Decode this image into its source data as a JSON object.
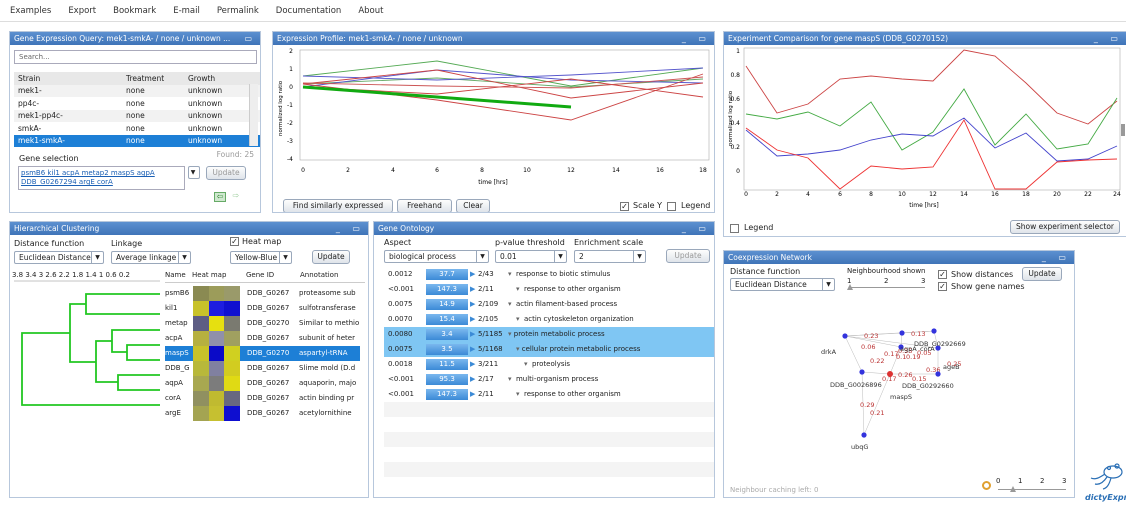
{
  "menu": [
    "Examples",
    "Export",
    "Bookmark",
    "E-mail",
    "Permalink",
    "Documentation",
    "About"
  ],
  "query": {
    "title": "Gene Expression Query: mek1-smkA- / none / unknown ...",
    "search_placeholder": "Search...",
    "columns": [
      "Strain",
      "Treatment",
      "Growth"
    ],
    "rows": [
      {
        "strain": "mek1-",
        "treatment": "none",
        "growth": "unknown"
      },
      {
        "strain": "pp4c-",
        "treatment": "none",
        "growth": "unknown"
      },
      {
        "strain": "mek1-pp4c-",
        "treatment": "none",
        "growth": "unknown"
      },
      {
        "strain": "smkA-",
        "treatment": "none",
        "growth": "unknown"
      },
      {
        "strain": "mek1-smkA-",
        "treatment": "none",
        "growth": "unknown"
      }
    ],
    "found": "Found: 25",
    "gene_selection_label": "Gene selection",
    "genes_line1": "psmB6 kil1 acpA metap2 maspS agpA",
    "genes_line2": "DDB_G0267294 argE corA",
    "update_label": "Update"
  },
  "profile": {
    "title": "Expression Profile: mek1-smkA- / none / unknown",
    "find_label": "Find similarly expressed",
    "freehand_label": "Freehand",
    "clear_label": "Clear",
    "scale_y_label": "Scale Y",
    "legend_label": "Legend",
    "chart": {
      "xlabel": "time [hrs]",
      "ylabel": "normalized log ratio",
      "xticks": [
        "0",
        "2",
        "4",
        "6",
        "8",
        "10",
        "12",
        "14",
        "16",
        "18"
      ],
      "yticks": [
        "2",
        "1",
        "0",
        "-1",
        "-2",
        "-3",
        "-4"
      ]
    }
  },
  "comparison": {
    "title": "Experiment Comparison for gene maspS (DDB_G0270152)",
    "legend_label": "Legend",
    "show_selector_label": "Show experiment selector",
    "chart": {
      "xlabel": "time [hrs]",
      "ylabel": "normalized log ratio",
      "xticks": [
        "0",
        "2",
        "4",
        "6",
        "8",
        "10",
        "12",
        "14",
        "16",
        "18",
        "20",
        "22",
        "24"
      ],
      "yticks": [
        "1",
        "0.8",
        "0.6",
        "0.4",
        "0.2",
        "0"
      ]
    }
  },
  "hc": {
    "title": "Hierarchical Clustering",
    "distance_label": "Distance function",
    "distance_value": "Euclidean Distance",
    "linkage_label": "Linkage",
    "linkage_value": "Average linkage",
    "heatmap_label": "Heat map",
    "color_value": "Yellow-Blue",
    "update_label": "Update",
    "scale": "3.8 3.4  3  2.6 2.2 1.8 1.4  1  0.6 0.2",
    "columns": [
      "Name",
      "Heat map",
      "Gene ID",
      "Annotation"
    ],
    "rows": [
      {
        "name": "psmB6",
        "id": "DDB_G0267",
        "ann": "proteasome sub"
      },
      {
        "name": "kil1",
        "id": "DDB_G0267",
        "ann": "sulfotransferase"
      },
      {
        "name": "metap",
        "id": "DDB_G0270",
        "ann": "Similar to methio"
      },
      {
        "name": "acpA",
        "id": "DDB_G0267",
        "ann": "subunit of heter"
      },
      {
        "name": "maspS",
        "id": "DDB_G0270",
        "ann": "aspartyl-tRNA"
      },
      {
        "name": "DDB_G",
        "id": "DDB_G0267",
        "ann": "Slime mold (D.d"
      },
      {
        "name": "aqpA",
        "id": "DDB_G0267",
        "ann": "aquaporin, majo"
      },
      {
        "name": "corA",
        "id": "DDB_G0267",
        "ann": "actin binding pr"
      },
      {
        "name": "argE",
        "id": "DDB_G0267",
        "ann": "acetylornithine"
      }
    ]
  },
  "go": {
    "title": "Gene Ontology",
    "aspect_label": "Aspect",
    "aspect_value": "biological process",
    "pvalue_label": "p-value threshold",
    "pvalue_value": "0.01",
    "enrich_label": "Enrichment scale",
    "enrich_value": "2",
    "update_label": "Update",
    "rows": [
      {
        "p": "0.0012",
        "score": "37.7",
        "count": "2/43",
        "term": "response to biotic stimulus",
        "indent": 0,
        "hl": false
      },
      {
        "p": "<0.001",
        "score": "147.3",
        "count": "2/11",
        "term": "response to other organism",
        "indent": 1,
        "hl": false
      },
      {
        "p": "0.0075",
        "score": "14.9",
        "count": "2/109",
        "term": "actin filament-based process",
        "indent": 0,
        "hl": false
      },
      {
        "p": "0.0070",
        "score": "15.4",
        "count": "2/105",
        "term": "actin cytoskeleton organization",
        "indent": 1,
        "hl": false
      },
      {
        "p": "0.0080",
        "score": "3.4",
        "count": "5/1185",
        "term": "protein metabolic process",
        "indent": 0,
        "hl": true
      },
      {
        "p": "0.0075",
        "score": "3.5",
        "count": "5/1168",
        "term": "cellular protein metabolic process",
        "indent": 1,
        "hl": true
      },
      {
        "p": "0.0018",
        "score": "11.5",
        "count": "3/211",
        "term": "proteolysis",
        "indent": 2,
        "hl": false
      },
      {
        "p": "<0.001",
        "score": "95.3",
        "count": "2/17",
        "term": "multi-organism process",
        "indent": 0,
        "hl": false
      },
      {
        "p": "<0.001",
        "score": "147.3",
        "count": "2/11",
        "term": "response to other organism",
        "indent": 1,
        "hl": false
      }
    ]
  },
  "coex": {
    "title": "Coexpression Network",
    "distance_label": "Distance function",
    "distance_value": "Euclidean Distance",
    "neigh_label": "Neighbourhood shown",
    "neigh_ticks": [
      "1",
      "2",
      "3"
    ],
    "show_distances_label": "Show distances",
    "show_names_label": "Show gene names",
    "update_label": "Update",
    "caching": "Neighbour caching left: 0",
    "zoom_ticks": [
      "0",
      "1",
      "2",
      "3"
    ],
    "node_labels": [
      "drkA",
      "agpA",
      "corA",
      "DDB_G0292669",
      "ageB",
      "DDB_G0026896",
      "DDB_G0292660",
      "maspS",
      "ubqG"
    ],
    "edge_labels": [
      "0.23",
      "0.13",
      "0.06",
      "0.17",
      "0.22",
      "0.1",
      "0.19",
      "0.05",
      "0.35",
      "0.25",
      "0.17",
      "0.26",
      "0.15",
      "0.36",
      "0.29",
      "0.21"
    ]
  },
  "logo_text": "dictyExpress",
  "colors": {
    "header": "#4a80c4",
    "selected": "#1d7fd6",
    "highlight": "#7fc6f3"
  }
}
